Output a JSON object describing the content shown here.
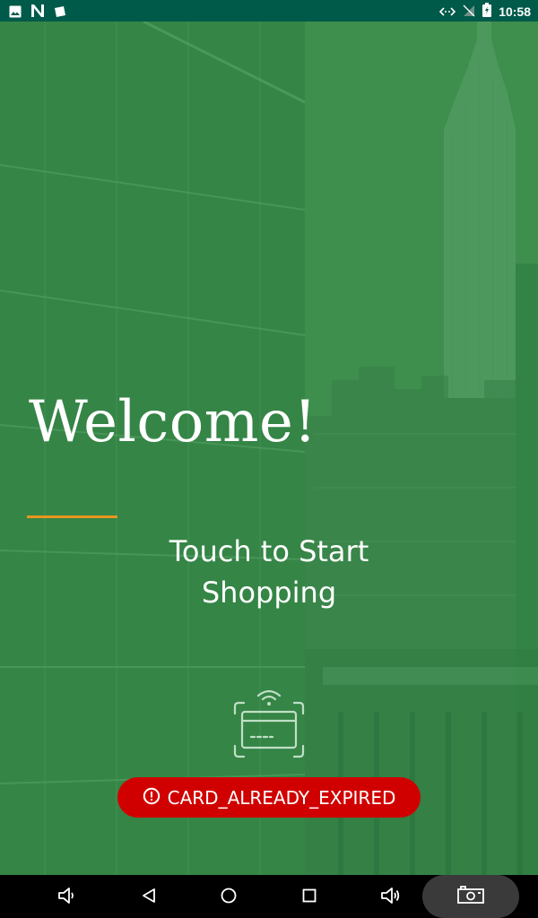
{
  "status_bar": {
    "time": "10:58",
    "left_icons": [
      "image-icon",
      "n-icon",
      "note-icon"
    ],
    "right_icons": [
      "wifi-arrows-icon",
      "no-signal-icon",
      "battery-icon"
    ]
  },
  "welcome": {
    "title": "Welcome!",
    "subtitle": "Touch to Start Shopping"
  },
  "card_reader": {
    "icon": "contactless-card-icon"
  },
  "error": {
    "icon": "alert-circle-icon",
    "message": "CARD_ALREADY_EXPIRED",
    "color": "#d10000"
  },
  "colors": {
    "status_bar": "#005a4a",
    "background": "#3e8e4e",
    "accent": "#e8961e"
  },
  "nav_bar": {
    "buttons": [
      "volume-down-icon",
      "back-icon",
      "home-icon",
      "recents-icon",
      "volume-up-icon",
      "screenshot-icon"
    ]
  }
}
